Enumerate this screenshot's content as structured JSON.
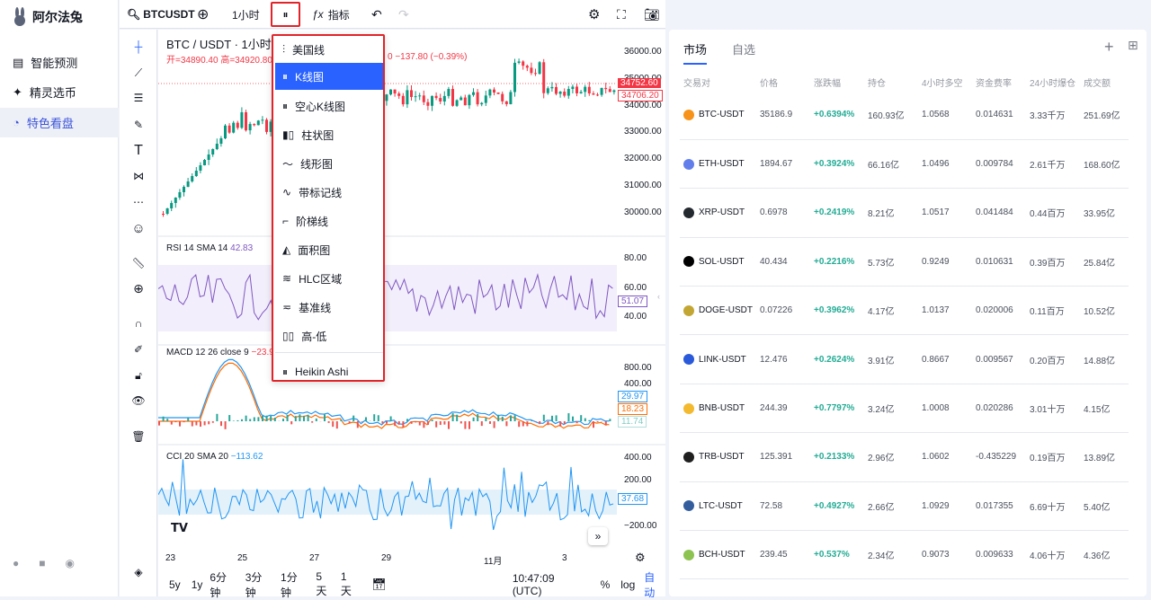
{
  "app": {
    "name": "阿尔法兔",
    "nav": [
      {
        "label": "智能预测"
      },
      {
        "label": "精灵选币"
      },
      {
        "label": "特色看盘"
      }
    ]
  },
  "toolbar": {
    "symbol": "BTCUSDT",
    "interval": "1小时",
    "indicators": "指标"
  },
  "chart": {
    "title": "BTC / USDT · 1小时 ·",
    "ohlc": "开=34890.40  高=34920.80",
    "change": "0  −137.80 (−0.39%)",
    "price_badge": "34752.60",
    "price_badge2": "34706.20",
    "price_ticks": [
      "36000.00",
      "35000.00",
      "34000.00",
      "33000.00",
      "32000.00",
      "31000.00",
      "30000.00"
    ],
    "rsi": {
      "label": "RSI 14 SMA 14",
      "value": "42.83",
      "ticks": [
        "80.00",
        "60.00",
        "40.00"
      ],
      "badge": "51.07"
    },
    "macd": {
      "label": "MACD 12 26 close 9",
      "value": "−23.9",
      "ticks": [
        "800.00",
        "400.00"
      ],
      "badges": [
        "29.97",
        "18.23",
        "11.74"
      ]
    },
    "cci": {
      "label": "CCI 20 SMA 20",
      "value": "−113.62",
      "ticks": [
        "400.00",
        "200.00",
        "−200.00"
      ],
      "badge": "37.68"
    },
    "x_ticks": [
      "23",
      "25",
      "27",
      "29",
      "11月",
      "3"
    ],
    "timeframes": [
      "5y",
      "1y",
      "6分钟",
      "3分钟",
      "1分钟",
      "5天",
      "1天"
    ],
    "clock": "10:47:09 (UTC)",
    "pct": "%",
    "log": "log",
    "auto": "自动"
  },
  "chart_types_menu": [
    "美国线",
    "K线图",
    "空心K线图",
    "柱状图",
    "线形图",
    "带标记线",
    "阶梯线",
    "面积图",
    "HLC区域",
    "基准线",
    "高-低",
    "Heikin Ashi"
  ],
  "market": {
    "tabs": [
      "市场",
      "自选"
    ],
    "columns": [
      "交易对",
      "价格",
      "涨跌幅",
      "持仓",
      "4小时多空",
      "资金费率",
      "24小时爆仓",
      "成交额"
    ],
    "rows": [
      [
        "BTC-USDT",
        "35186.9",
        "+0.6394%",
        "160.93亿",
        "1.0568",
        "0.014631",
        "3.33千万",
        "251.69亿"
      ],
      [
        "ETH-USDT",
        "1894.67",
        "+0.3924%",
        "66.16亿",
        "1.0496",
        "0.009784",
        "2.61千万",
        "168.60亿"
      ],
      [
        "XRP-USDT",
        "0.6978",
        "+0.2419%",
        "8.21亿",
        "1.0517",
        "0.041484",
        "0.44百万",
        "33.95亿"
      ],
      [
        "SOL-USDT",
        "40.434",
        "+0.2216%",
        "5.73亿",
        "0.9249",
        "0.010631",
        "0.39百万",
        "25.84亿"
      ],
      [
        "DOGE-USDT",
        "0.07226",
        "+0.3962%",
        "4.17亿",
        "1.0137",
        "0.020006",
        "0.11百万",
        "10.52亿"
      ],
      [
        "LINK-USDT",
        "12.476",
        "+0.2624%",
        "3.91亿",
        "0.8667",
        "0.009567",
        "0.20百万",
        "14.88亿"
      ],
      [
        "BNB-USDT",
        "244.39",
        "+0.7797%",
        "3.24亿",
        "1.0008",
        "0.020286",
        "3.01十万",
        "4.15亿"
      ],
      [
        "TRB-USDT",
        "125.391",
        "+0.2133%",
        "2.96亿",
        "1.0602",
        "-0.435229",
        "0.19百万",
        "13.89亿"
      ],
      [
        "LTC-USDT",
        "72.58",
        "+0.4927%",
        "2.66亿",
        "1.0929",
        "0.017355",
        "6.69十万",
        "5.40亿"
      ],
      [
        "BCH-USDT",
        "239.45",
        "+0.537%",
        "2.34亿",
        "0.9073",
        "0.009633",
        "4.06十万",
        "4.36亿"
      ]
    ]
  },
  "coin_colors": [
    "#f7931a",
    "#627eea",
    "#23292f",
    "#000000",
    "#c2a633",
    "#2a5ada",
    "#f3ba2f",
    "#1f1f1f",
    "#345d9d",
    "#8dc351"
  ]
}
